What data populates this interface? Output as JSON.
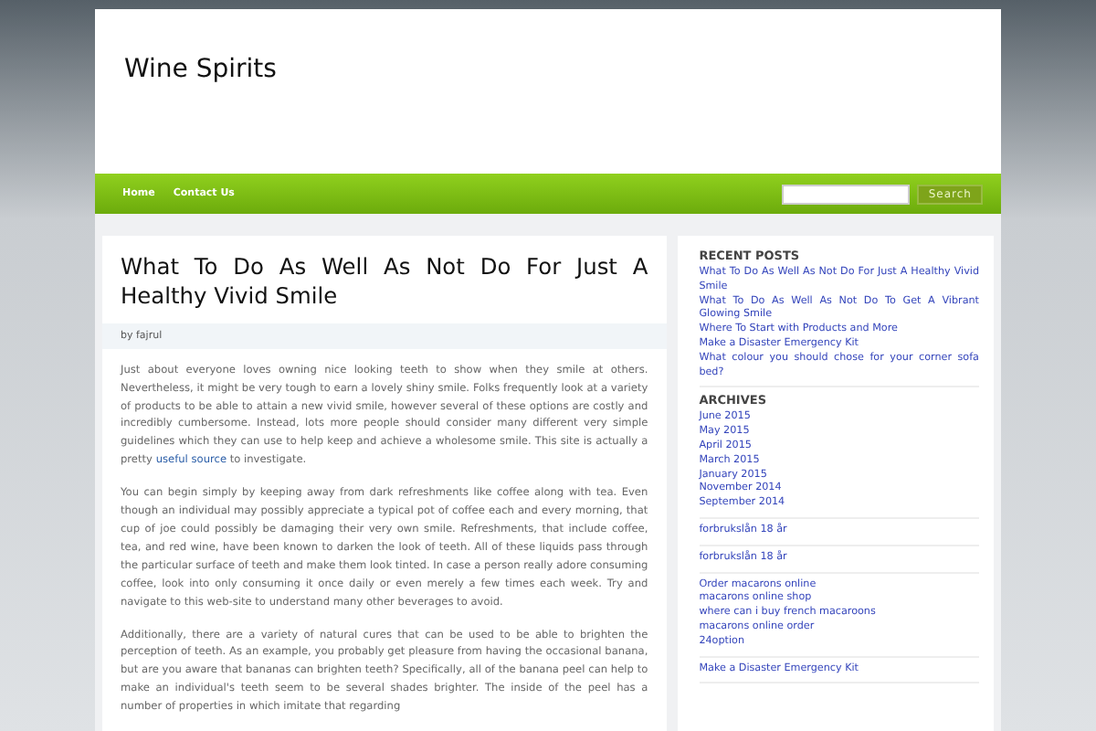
{
  "site": {
    "title": "Wine Spirits"
  },
  "nav": {
    "items": [
      {
        "label": "Home"
      },
      {
        "label": "Contact Us"
      }
    ],
    "search": {
      "button": "Search"
    }
  },
  "post": {
    "title": "What To Do As Well As Not Do For Just A Healthy Vivid Smile",
    "byline": "by fajrul",
    "paragraphs": [
      [
        {
          "kind": "text",
          "text": "Just about everyone loves owning nice looking teeth to show when they smile at others. Nevertheless, it might be very tough to earn a lovely shiny smile. Folks frequently look at a variety of products to be able to attain a new vivid smile, however several of these options are costly and incredibly cumbersome. Instead, lots more people should consider many different very simple guidelines which they can use to help keep and achieve a wholesome smile. This site is actually a pretty "
        },
        {
          "kind": "link",
          "text": "useful source"
        },
        {
          "kind": "text",
          "text": " to investigate."
        }
      ],
      [
        {
          "kind": "text",
          "text": "You can begin simply by keeping away from dark refreshments like coffee along with tea. Even though an individual may possibly appreciate a typical pot of coffee each and every morning, that cup of joe could possibly be damaging their very own smile. Refreshments, that include coffee, tea, and red wine, have been known to darken the look of teeth. All of these liquids pass through the particular surface of teeth and make them look tinted. In case a person really adore consuming coffee, look into only consuming it once daily or even merely a few times each week. Try and navigate to this web-site to understand many other beverages to avoid."
        }
      ],
      [
        {
          "kind": "text",
          "text": "Additionally, there are a variety of natural cures that can be used to be able to brighten the perception of teeth. As an example, you probably get pleasure from having the occasional banana, but are you aware that bananas can brighten teeth? Specifically, all of the banana peel can help to make an individual's teeth seem to be several shades brighter. The inside of the peel has a number of properties in which imitate that regarding"
        }
      ]
    ]
  },
  "sidebar": {
    "sections": [
      {
        "heading": "RECENT POSTS",
        "links": [
          "What To Do As Well As Not Do For Just A Healthy Vivid Smile",
          "What To Do As Well As Not Do To Get A Vibrant Glowing Smile",
          "Where To Start with Products and More",
          "Make a Disaster Emergency Kit",
          "What colour you should chose for your corner sofa bed?"
        ]
      },
      {
        "heading": "ARCHIVES",
        "links": [
          "June 2015",
          "May 2015",
          "April 2015",
          "March 2015",
          "January 2015",
          "November 2014",
          "September 2014"
        ]
      },
      {
        "links": [
          "forbrukslån 18 år"
        ]
      },
      {
        "links": [
          "forbrukslån 18 år"
        ]
      },
      {
        "links": [
          "Order macarons online",
          "macarons online shop",
          "where can i buy french macaroons",
          "macarons online order",
          "24option"
        ]
      },
      {
        "links": [
          "Make a Disaster Emergency Kit"
        ]
      }
    ]
  }
}
